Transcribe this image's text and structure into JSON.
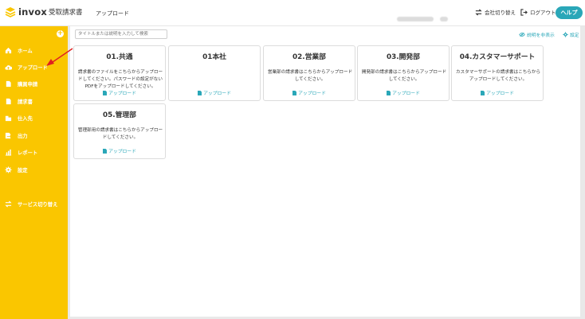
{
  "app": {
    "logo_text": "invox",
    "logo_sub": "受取請求書",
    "page_title": "アップロード"
  },
  "header": {
    "switch_company": "会社切り替え",
    "logout": "ログアウト",
    "help": "ヘルプ"
  },
  "sidebar": {
    "items": [
      {
        "label": "ホーム",
        "icon": "home-icon"
      },
      {
        "label": "アップロード",
        "icon": "cloud-upload-icon"
      },
      {
        "label": "購買申請",
        "icon": "document-icon"
      },
      {
        "label": "請求書",
        "icon": "document-icon"
      },
      {
        "label": "仕入先",
        "icon": "building-icon"
      },
      {
        "label": "出力",
        "icon": "export-icon"
      },
      {
        "label": "レポート",
        "icon": "chart-icon"
      },
      {
        "label": "設定",
        "icon": "gear-icon"
      },
      {
        "label": "サービス切り替え",
        "icon": "switch-icon"
      }
    ]
  },
  "toolbar": {
    "search_placeholder": "タイトルまたは説明を入力して検索",
    "hide_description": "説明を非表示",
    "settings": "設定"
  },
  "cards": [
    {
      "title": "01.共通",
      "description": "請求書のファイルをこちらからアップロードしてください。パスワードの設定がないPDFをアップロードしてください。",
      "upload": "アップロード"
    },
    {
      "title": "01本社",
      "description": "",
      "upload": "アップロード"
    },
    {
      "title": "02.営業部",
      "description": "営業部の請求書はこちらからアップロードしてください。",
      "upload": "アップロード"
    },
    {
      "title": "03.開発部",
      "description": "開発部の請求書はこちらからアップロードしてください。",
      "upload": "アップロード"
    },
    {
      "title": "04.カスタマーサポート",
      "description": "カスタマーサポートの請求書はこちらからアップロードしてください。",
      "upload": "アップロード"
    },
    {
      "title": "05.管理部",
      "description": "管理部用の請求書はこちらからアップロードしてください。",
      "upload": "アップロード"
    }
  ],
  "colors": {
    "sidebar": "#fac600",
    "accent": "#2aa7b8",
    "annotation_arrow": "#e02020"
  }
}
